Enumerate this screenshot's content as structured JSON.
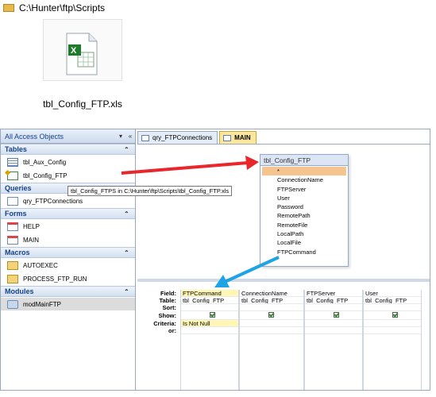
{
  "explorer": {
    "path": "C:\\Hunter\\ftp\\Scripts",
    "file_name": "tbl_Config_FTP.xls"
  },
  "nav": {
    "header": "All Access Objects",
    "groups": [
      {
        "label": "Tables",
        "items": [
          {
            "label": "tbl_Aux_Config",
            "icon": "table-icon"
          },
          {
            "label": "tbl_Config_FTP",
            "icon": "linked-excel-icon"
          }
        ]
      },
      {
        "label": "Queries",
        "items": [
          {
            "label": "qry_FTPConnections",
            "icon": "query-icon"
          }
        ]
      },
      {
        "label": "Forms",
        "items": [
          {
            "label": "HELP",
            "icon": "form-icon"
          },
          {
            "label": "MAIN",
            "icon": "form-icon"
          }
        ]
      },
      {
        "label": "Macros",
        "items": [
          {
            "label": "AUTOEXEC",
            "icon": "macro-icon"
          },
          {
            "label": "PROCESS_FTP_RUN",
            "icon": "macro-icon"
          }
        ]
      },
      {
        "label": "Modules",
        "items": [
          {
            "label": "modMainFTP",
            "icon": "module-icon"
          }
        ]
      }
    ],
    "tooltip": "tbl_Config_FTPS in C:\\Hunter\\ftp\\Scripts\\tbl_Config_FTP.xls"
  },
  "tabs": [
    {
      "label": "qry_FTPConnections"
    },
    {
      "label": "MAIN"
    }
  ],
  "field_list": {
    "title": "tbl_Config_FTP",
    "fields": [
      "*",
      "ConnectionName",
      "FTPServer",
      "User",
      "Password",
      "RemotePath",
      "RemoteFile",
      "LocalPath",
      "LocalFile",
      "FTPCommand"
    ]
  },
  "grid": {
    "row_labels": [
      "Field:",
      "Table:",
      "Sort:",
      "Show:",
      "Criteria:",
      "or:"
    ],
    "columns": [
      {
        "field": "FTPCommand",
        "table": "tbl_Config_FTP",
        "criteria": "Is Not Null"
      },
      {
        "field": "ConnectionName",
        "table": "tbl_Config_FTP",
        "criteria": ""
      },
      {
        "field": "FTPServer",
        "table": "tbl_Config_FTP",
        "criteria": ""
      },
      {
        "field": "User",
        "table": "tbl_Config_FTP",
        "criteria": ""
      }
    ]
  },
  "colors": {
    "arrow_red": "#e8262b",
    "arrow_blue": "#1ea4e6",
    "active_tab": "#fde79a"
  }
}
